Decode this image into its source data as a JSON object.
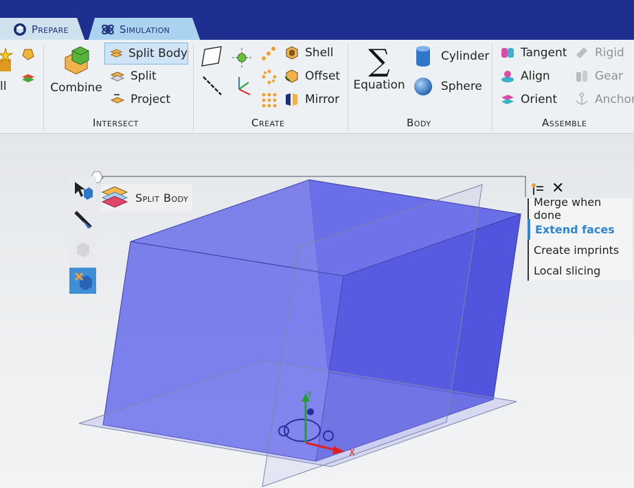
{
  "tabs": [
    {
      "label": "Prepare",
      "icon": "prepare-cube-icon"
    },
    {
      "label": "Simulation",
      "icon": "simulation-atom-icon",
      "active": true
    }
  ],
  "ribbon": {
    "left_partial": {
      "label_fragment": "ll"
    },
    "intersect": {
      "label": "Intersect",
      "combine": "Combine",
      "split_body": "Split Body",
      "split": "Split",
      "project": "Project"
    },
    "create": {
      "label": "Create",
      "shell": "Shell",
      "offset": "Offset",
      "mirror": "Mirror"
    },
    "body": {
      "label": "Body",
      "equation": "Equation",
      "cylinder": "Cylinder",
      "sphere": "Sphere"
    },
    "assemble": {
      "label": "Assemble",
      "tangent": "Tangent",
      "align": "Align",
      "orient": "Orient",
      "rigid": "Rigid",
      "gear": "Gear",
      "anchor": "Anchor"
    }
  },
  "tool_panel": {
    "title": "Split Body",
    "options": [
      {
        "label": "Merge when done",
        "active": false
      },
      {
        "label": "Extend faces",
        "active": true
      },
      {
        "label": "Create imprints",
        "active": false
      },
      {
        "label": "Local slicing",
        "active": false
      }
    ],
    "close": "✕"
  },
  "viewport": {
    "axis_x": "X",
    "axis_y": "Y",
    "colors": {
      "body_fill": "#5b5fe6",
      "axis_x": "#e02020",
      "axis_y": "#1fa02a"
    }
  }
}
